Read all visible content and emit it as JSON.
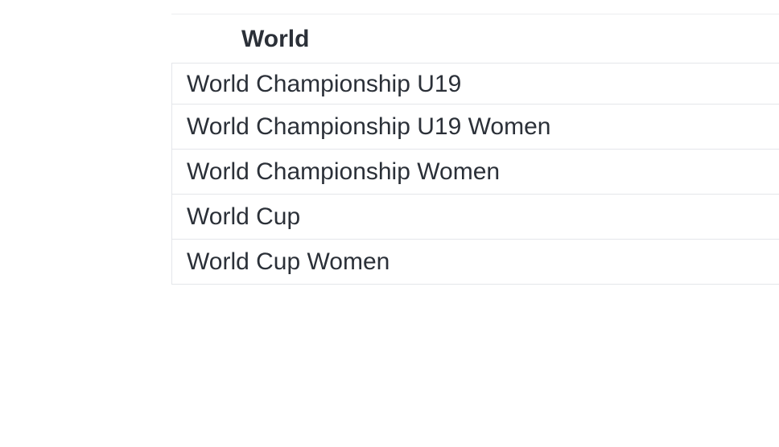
{
  "section": {
    "title": "World"
  },
  "competitions": [
    {
      "label": "World Championship U19"
    },
    {
      "label": "World Championship U19 Women"
    },
    {
      "label": "World Championship Women"
    },
    {
      "label": "World Cup"
    },
    {
      "label": "World Cup Women"
    }
  ]
}
